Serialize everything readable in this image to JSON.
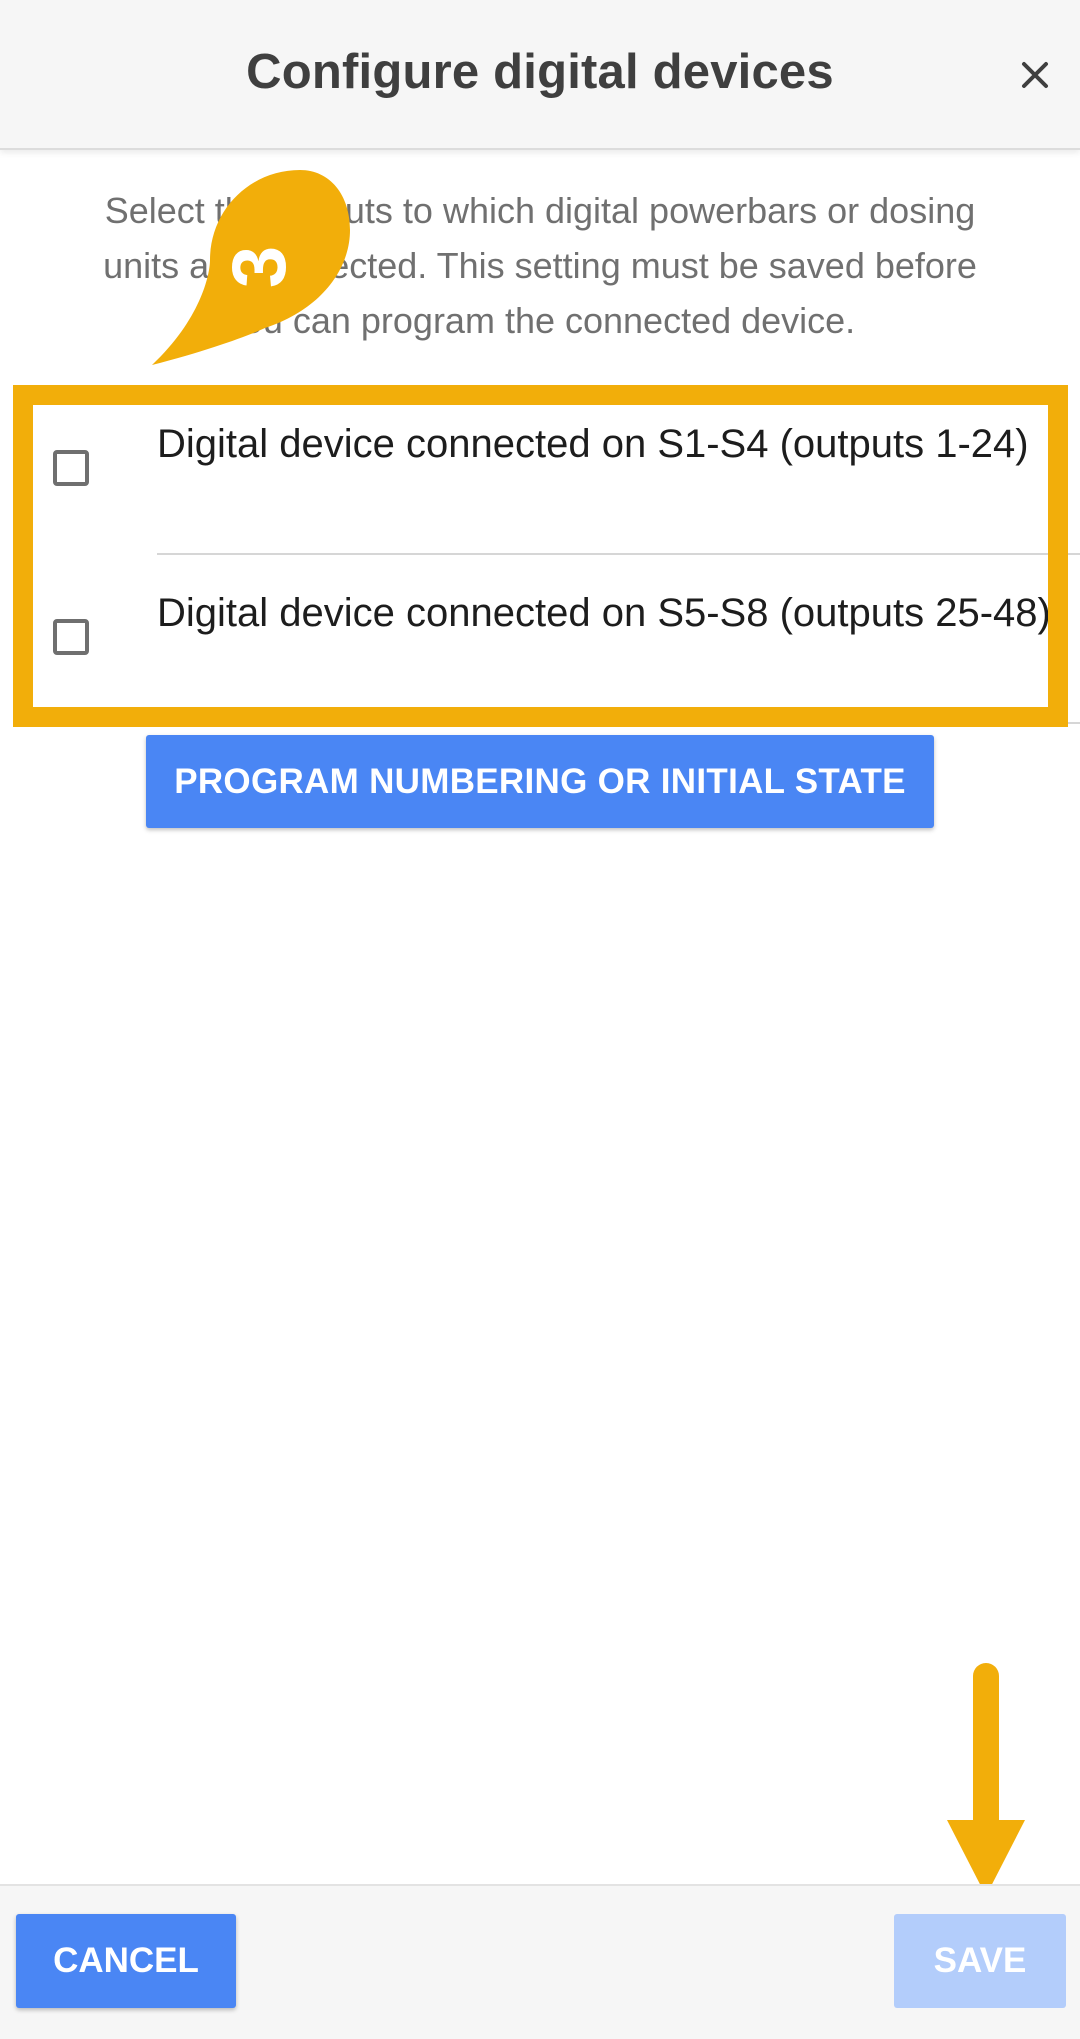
{
  "header": {
    "title": "Configure digital devices",
    "close_icon": "close-icon"
  },
  "description": "Select the outputs to which digital powerbars or dosing units are connected. This setting must be saved before you can program the connected device.",
  "options": [
    {
      "label": "Digital device connected on S1-S4 (outputs 1-24)",
      "checked": false
    },
    {
      "label": "Digital device connected on S5-S8 (outputs 25-48)",
      "checked": false
    }
  ],
  "program_button": {
    "label": "PROGRAM NUMBERING OR INITIAL STATE"
  },
  "annotation": {
    "step_number": "3",
    "accent_color": "#f2ae0a"
  },
  "footer": {
    "cancel_label": "CANCEL",
    "save_label": "SAVE"
  },
  "colors": {
    "primary": "#4a86f4",
    "disabled": "#b3cdfb"
  }
}
